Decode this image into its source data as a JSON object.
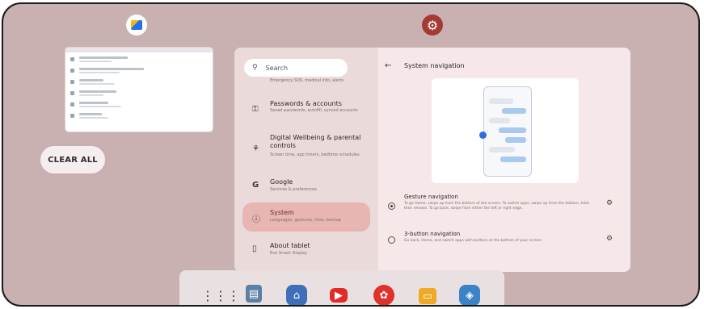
{
  "recents": {
    "files_app_icon": "files-icon",
    "settings_app_icon": "gear-icon",
    "clear_all_label": "CLEAR ALL"
  },
  "settings": {
    "search_placeholder": "Search",
    "search_sub": "Emergency SOS, medical info, alerts",
    "menu": [
      {
        "icon": "key-icon",
        "glyph": "⚿",
        "title": "Passwords & accounts",
        "subtitle": "Saved passwords, autofill, synced accounts"
      },
      {
        "icon": "wellbeing-icon",
        "glyph": "⚘",
        "title": "Digital Wellbeing & parental controls",
        "subtitle": "Screen time, app timers, bedtime schedules"
      },
      {
        "icon": "google-icon",
        "glyph": "G",
        "title": "Google",
        "subtitle": "Services & preferences"
      },
      {
        "icon": "info-icon",
        "glyph": "ⓘ",
        "title": "System",
        "subtitle": "Languages, gestures, time, backup"
      },
      {
        "icon": "tablet-icon",
        "glyph": "▯",
        "title": "About tablet",
        "subtitle": "Evo Smart Display"
      }
    ],
    "page": {
      "back_icon": "arrow-left-icon",
      "title": "System navigation"
    },
    "options": [
      {
        "title": "Gesture navigation",
        "description": "To go Home, swipe up from the bottom of the screen. To switch apps, swipe up from the bottom, hold, then release. To go back, swipe from either the left or right edge.",
        "selected": true
      },
      {
        "title": "3-button navigation",
        "description": "Go back, Home, and switch apps with buttons at the bottom of your screen.",
        "selected": false
      }
    ]
  },
  "dock": {
    "icons": [
      "apps-grid-icon",
      "files-icon",
      "photos-icon",
      "youtube-icon",
      "gift-icon",
      "screen-icon",
      "browser-icon"
    ]
  }
}
